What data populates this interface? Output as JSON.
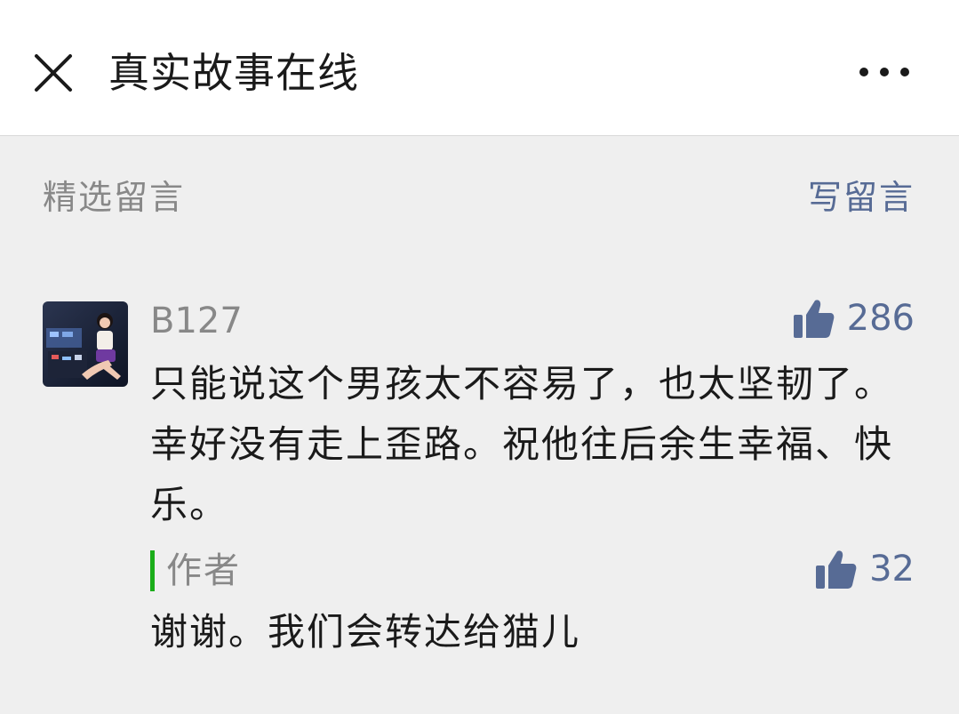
{
  "header": {
    "title": "真实故事在线",
    "close_icon": "close-icon",
    "more_icon": "more-icon"
  },
  "section": {
    "label": "精选留言",
    "write_label": "写留言"
  },
  "comment": {
    "nickname": "B127",
    "like_count": "286",
    "text": "只能说这个男孩太不容易了，也太坚韧了。幸好没有走上歪路。祝他往后余生幸福、快乐。",
    "reply": {
      "author_label": "作者",
      "like_count": "32",
      "text": "谢谢。我们会转达给猫儿"
    }
  },
  "colors": {
    "link": "#576b95",
    "accent_bar": "#1aad19",
    "background": "#efefef"
  }
}
